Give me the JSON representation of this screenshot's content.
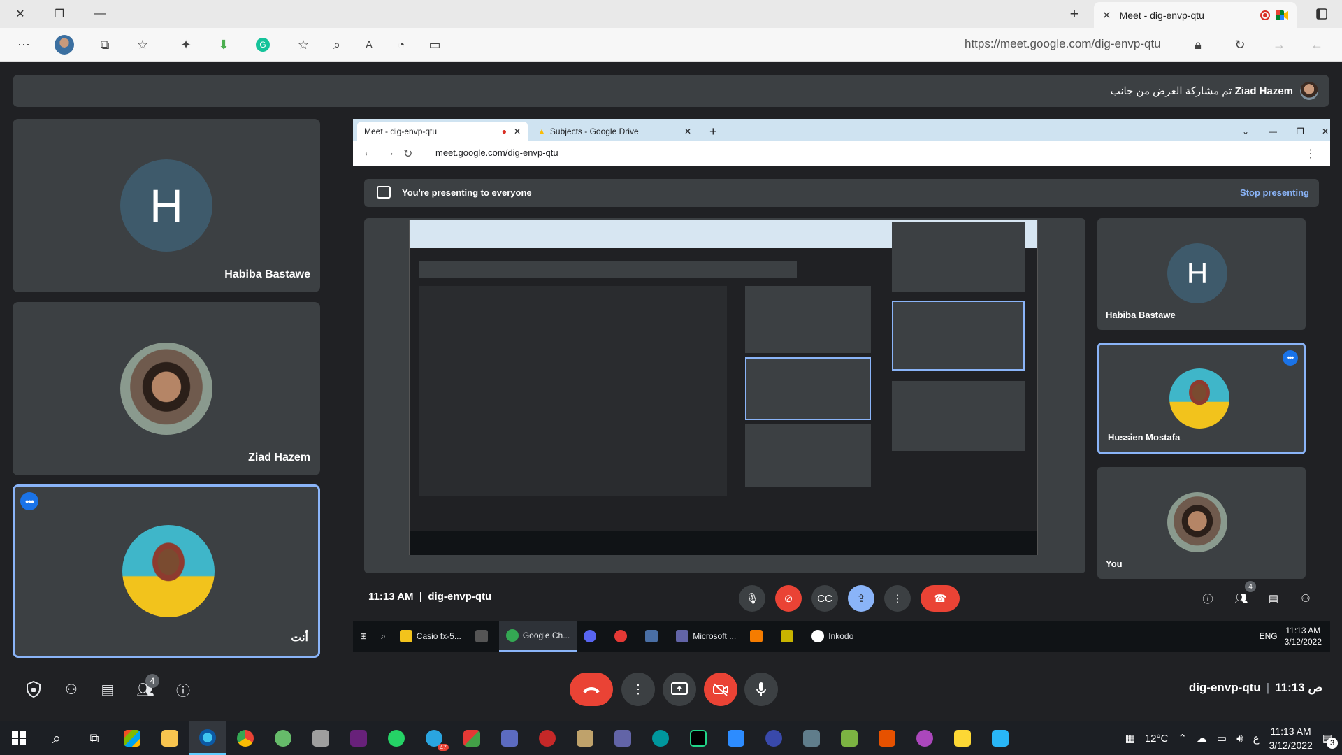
{
  "browser": {
    "tab_title": "Meet - dig-envp-qtu",
    "url": "https://meet.google.com/dig-envp-qtu"
  },
  "banner": {
    "text": "تم مشاركة العرض من جانب",
    "presenter": "Ziad Hazem"
  },
  "participants": [
    {
      "name": "Habiba Bastawe",
      "initial": "H",
      "avatar_color": "#3e5a6b"
    },
    {
      "name": "Ziad Hazem",
      "avatar": "photo"
    },
    {
      "name": "أنت",
      "avatar": "photo",
      "highlighted": true
    }
  ],
  "shared_screen": {
    "tabs": [
      "Meet - dig-envp-qtu",
      "Subjects - Google Drive"
    ],
    "url": "meet.google.com/dig-envp-qtu",
    "presenting_text": "You're presenting to everyone",
    "stop_presenting": "Stop presenting",
    "tiles": [
      {
        "name": "Habiba Bastawe",
        "initial": "H"
      },
      {
        "name": "Hussien Mostafa"
      },
      {
        "name": "You"
      }
    ],
    "time": "11:13 AM",
    "meeting_code": "dig-envp-qtu",
    "people_count": "4",
    "taskbar_items": [
      "Casio fx-5...",
      "Google Ch...",
      "Microsoft ...",
      "Inkodo"
    ],
    "tray_lang": "ENG",
    "tray_time": "11:13 AM",
    "tray_date": "3/12/2022"
  },
  "toolbar": {
    "people_count": "4",
    "meeting_code": "dig-envp-qtu",
    "time": "11:13 ص"
  },
  "taskbar": {
    "weather": "12°C",
    "lang": "ع",
    "time": "11:13 AM",
    "date": "3/12/2022",
    "notifications": "3",
    "telegram_badge": "47"
  },
  "colors": {
    "meet_bg": "#202124",
    "tile_bg": "#3c4043",
    "accent_blue": "#8ab4f8",
    "danger_red": "#ea4335"
  }
}
